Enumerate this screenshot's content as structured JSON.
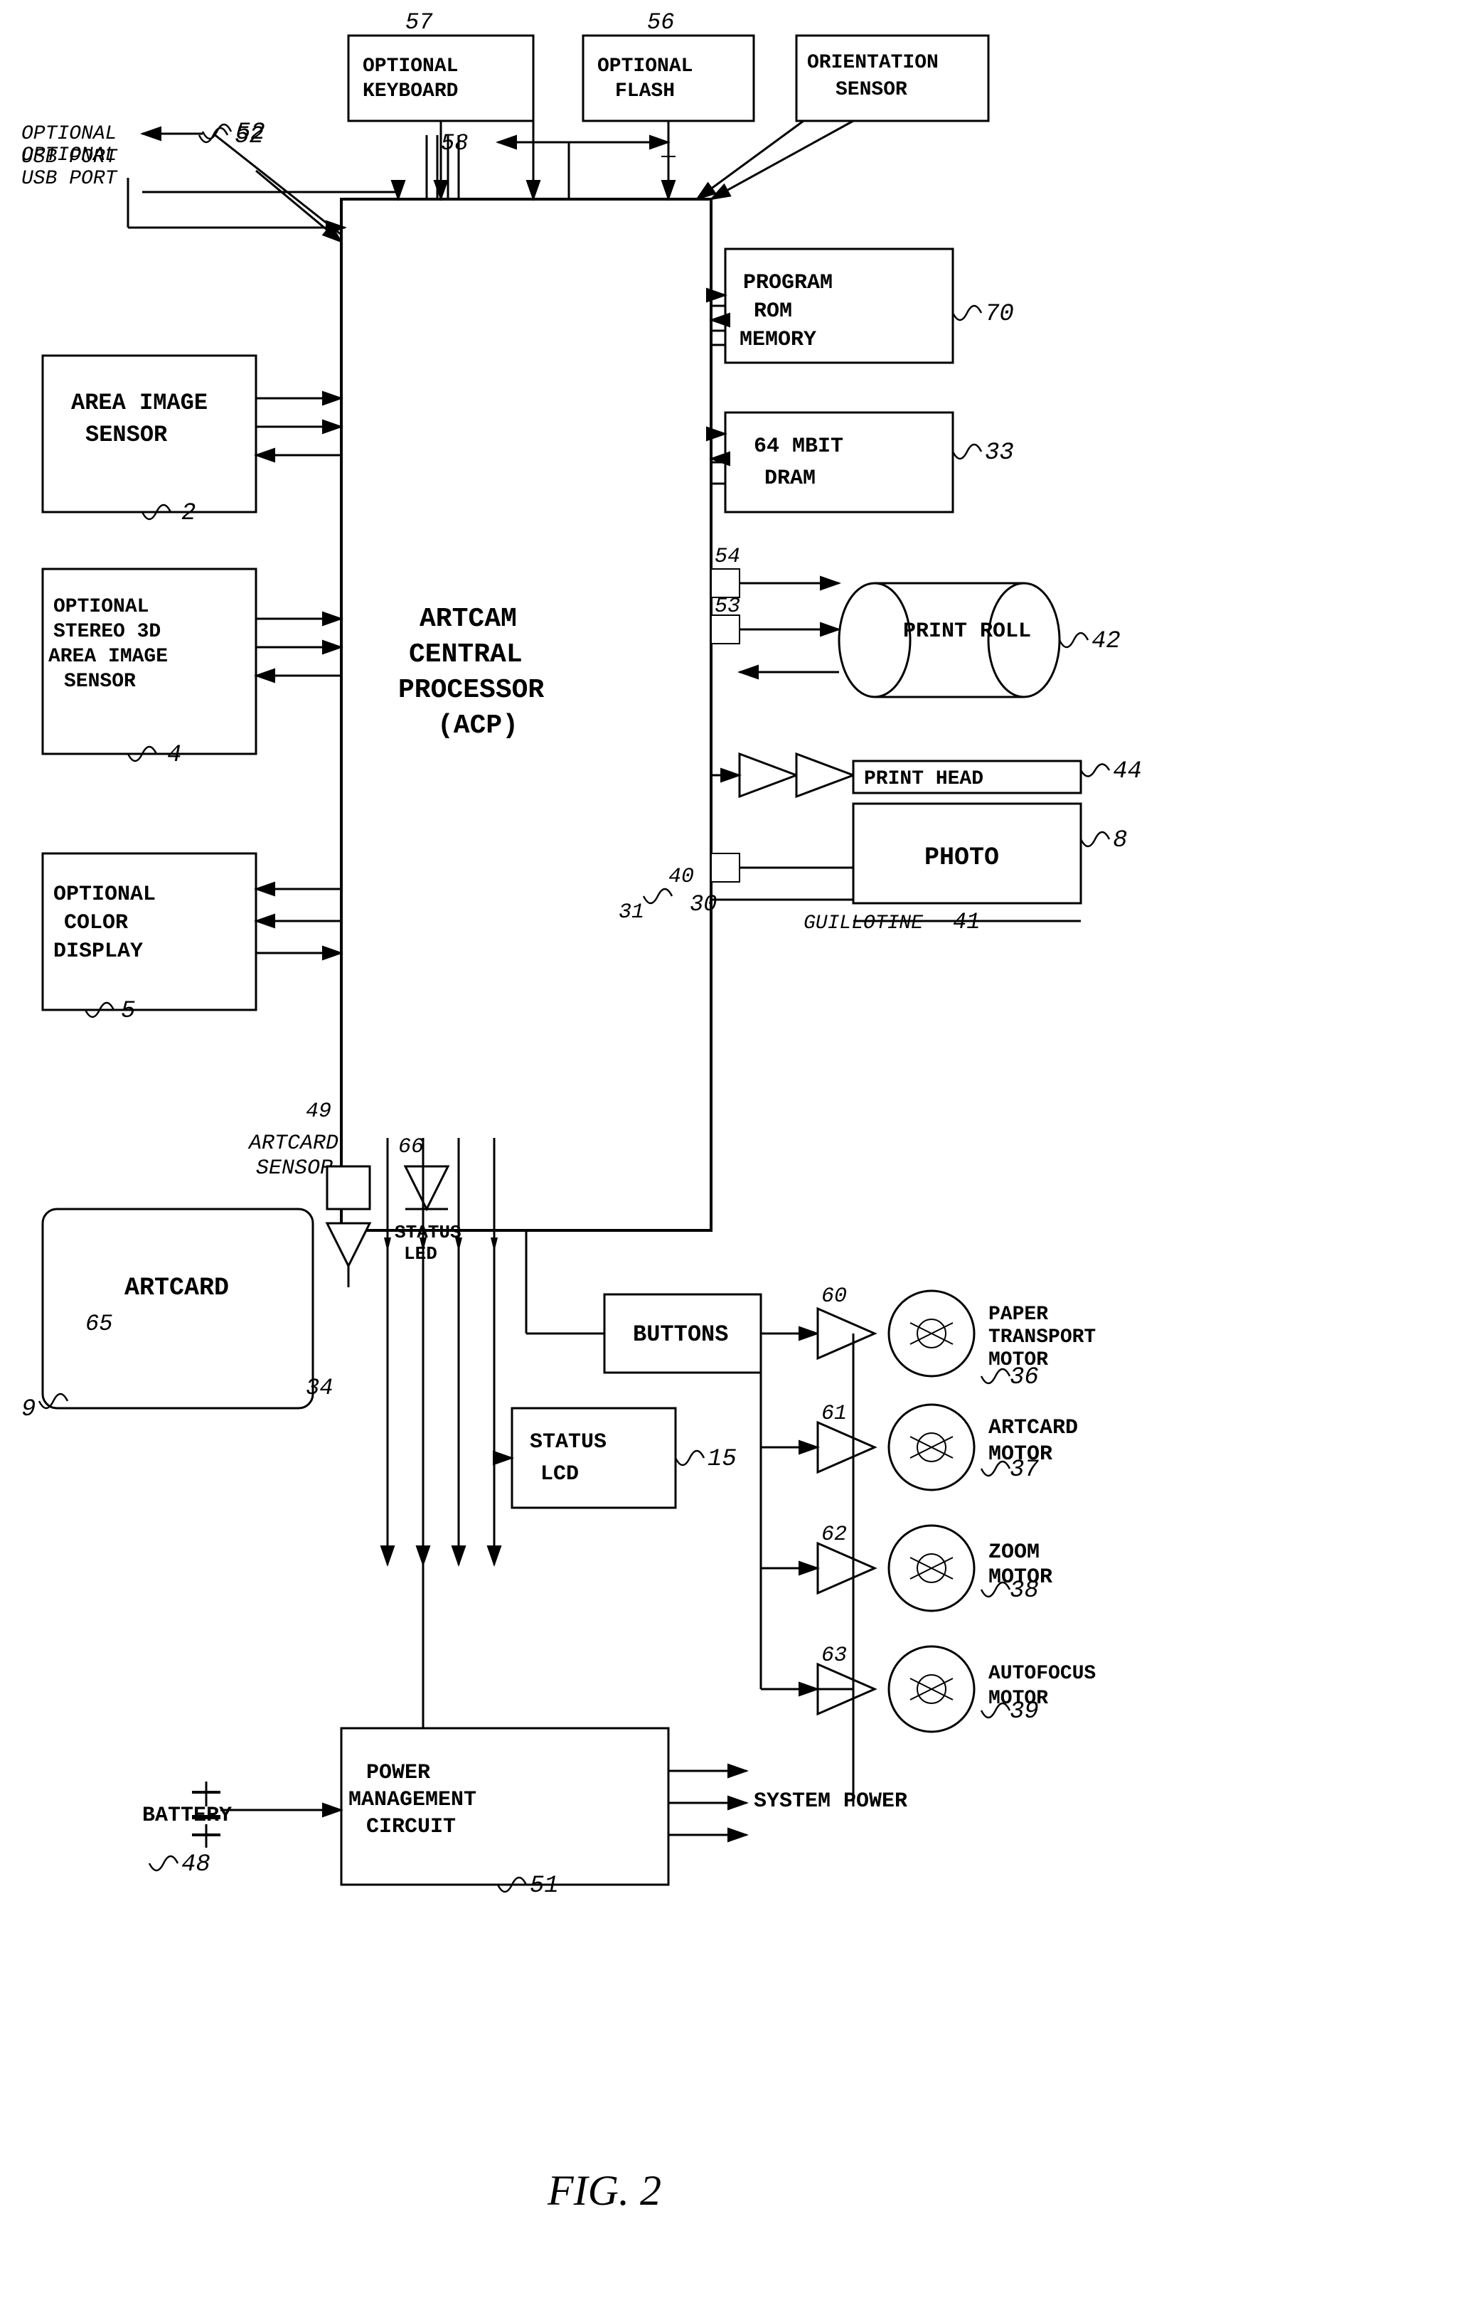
{
  "diagram": {
    "title": "FIG. 2",
    "components": {
      "area_image_sensor": "AREA IMAGE\nSENSOR",
      "optional_stereo": "OPTIONAL\nSTEREO 3D\nAREA IMAGE\nSENSOR",
      "optional_color_display": "OPTIONAL\nCOLOR\nDISPLAY",
      "artcam_central_processor": "ARTCAM\nCENTRAL\nPROCESSOR\n(ACP)",
      "program_rom": "PROGRAM\nROM\nMEMORY",
      "dram": "64 MBIT\nDRAM",
      "print_roll": "PRINT ROLL",
      "print_head": "PRINT HEAD",
      "photo": "PHOTO",
      "guillotine": "GUILLOTINE",
      "optional_keyboard": "OPTIONAL\nKEYBOARD",
      "optional_flash": "OPTIONAL\nFLASH",
      "orientation_sensor": "ORIENTATION\nSENSOR",
      "optional_usb": "OPTIONAL\nUSB PORT",
      "artcard_sensor": "ARTCARD\nSENSOR",
      "status_led": "STATUS\nLED",
      "artcard": "ARTCARD",
      "buttons": "BUTTONS",
      "status_lcd": "STATUS\nLCD",
      "battery": "BATTERY",
      "power_management": "POWER\nMANAGEMENT\nCIRCUIT",
      "system_power": "SYSTEM POWER",
      "paper_transport_motor": "PAPER\nTRANSPORT\nMOTOR",
      "artcard_motor": "ARTCARD\nMOTOR",
      "zoom_motor": "ZOOM\nMOTOR",
      "autofocus_motor": "AUTOFOCUS\nMOTOR"
    },
    "labels": {
      "2": "2",
      "4": "4",
      "5": "5",
      "8": "8",
      "9": "9",
      "15": "15",
      "30": "30",
      "31": "31",
      "33": "33",
      "34": "34",
      "36": "36",
      "37": "37",
      "38": "38",
      "39": "39",
      "40": "40",
      "41": "41",
      "42": "42",
      "44": "44",
      "48": "48",
      "49": "49",
      "51": "51",
      "52": "52",
      "53": "53",
      "54": "54",
      "56": "56",
      "57": "57",
      "58": "58",
      "60": "60",
      "61": "61",
      "62": "62",
      "63": "63",
      "65": "65",
      "66": "66",
      "70": "70"
    }
  }
}
